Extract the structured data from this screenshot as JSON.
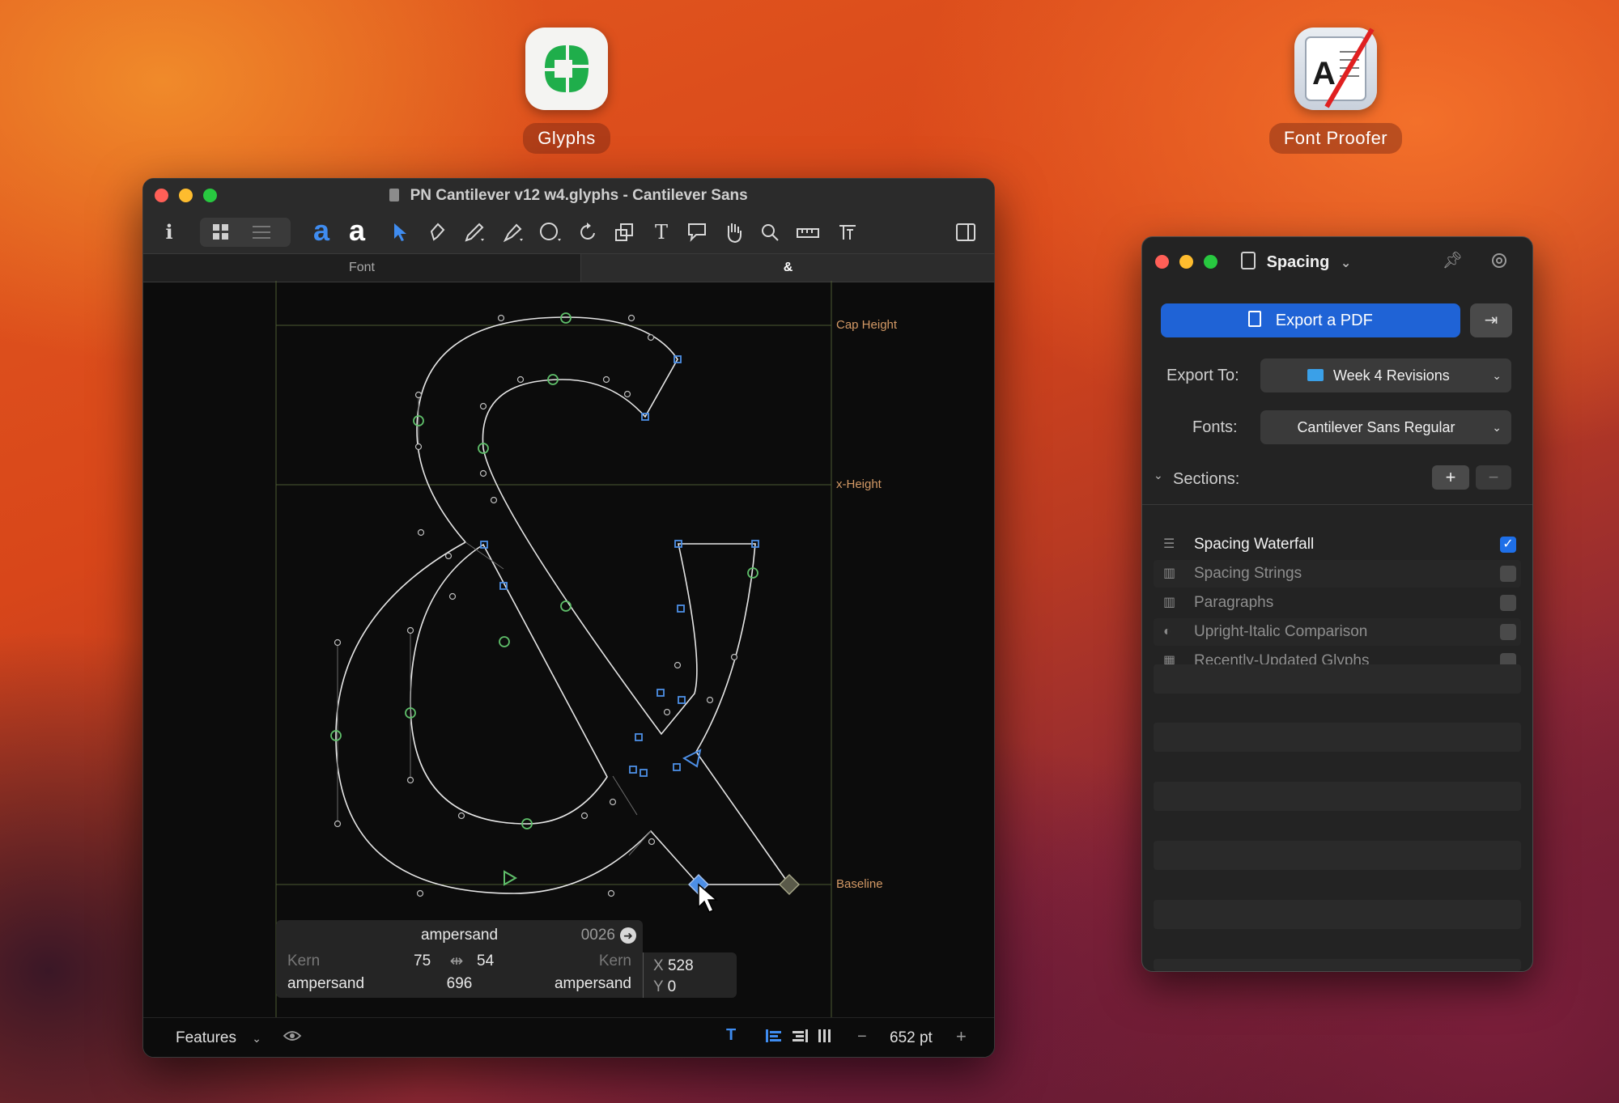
{
  "desktop": {
    "icons": [
      {
        "label": "Glyphs"
      },
      {
        "label": "Font Proofer"
      }
    ]
  },
  "main_window": {
    "title": "PN Cantilever v12 w4.glyphs - Cantilever Sans",
    "tabs": [
      {
        "label": "Font"
      },
      {
        "label": "&"
      }
    ],
    "metrics": {
      "cap_height": "Cap Height",
      "x_height": "x-Height",
      "baseline": "Baseline"
    },
    "glyph_info": {
      "name": "ampersand",
      "unicode": "0026",
      "kern_left_label": "Kern",
      "kern_right_label": "Kern",
      "lsb": "75",
      "rsb": "54",
      "width": "696",
      "left_group": "ampersand",
      "right_group": "ampersand",
      "x_label": "X",
      "x_value": "528",
      "y_label": "Y",
      "y_value": "0"
    },
    "status": {
      "features": "Features",
      "zoom": "652 pt",
      "minus": "−",
      "plus": "+"
    }
  },
  "spacing_panel": {
    "title": "Spacing",
    "export_button": "Export a PDF",
    "export_to_label": "Export To:",
    "export_to_value": "Week 4 Revisions",
    "fonts_label": "Fonts:",
    "fonts_value": "Cantilever Sans Regular",
    "sections_label": "Sections:",
    "sections": [
      {
        "label": "Spacing Waterfall",
        "checked": true
      },
      {
        "label": "Spacing Strings",
        "checked": false
      },
      {
        "label": "Paragraphs",
        "checked": false
      },
      {
        "label": "Upright-Italic Comparison",
        "checked": false
      },
      {
        "label": "Recently-Updated Glyphs",
        "checked": false
      }
    ]
  },
  "colors": {
    "accent_blue": "#1f63d6",
    "node_green": "#5fbf6a",
    "node_blue": "#4d8fe6",
    "metric_label": "#d49a66"
  }
}
